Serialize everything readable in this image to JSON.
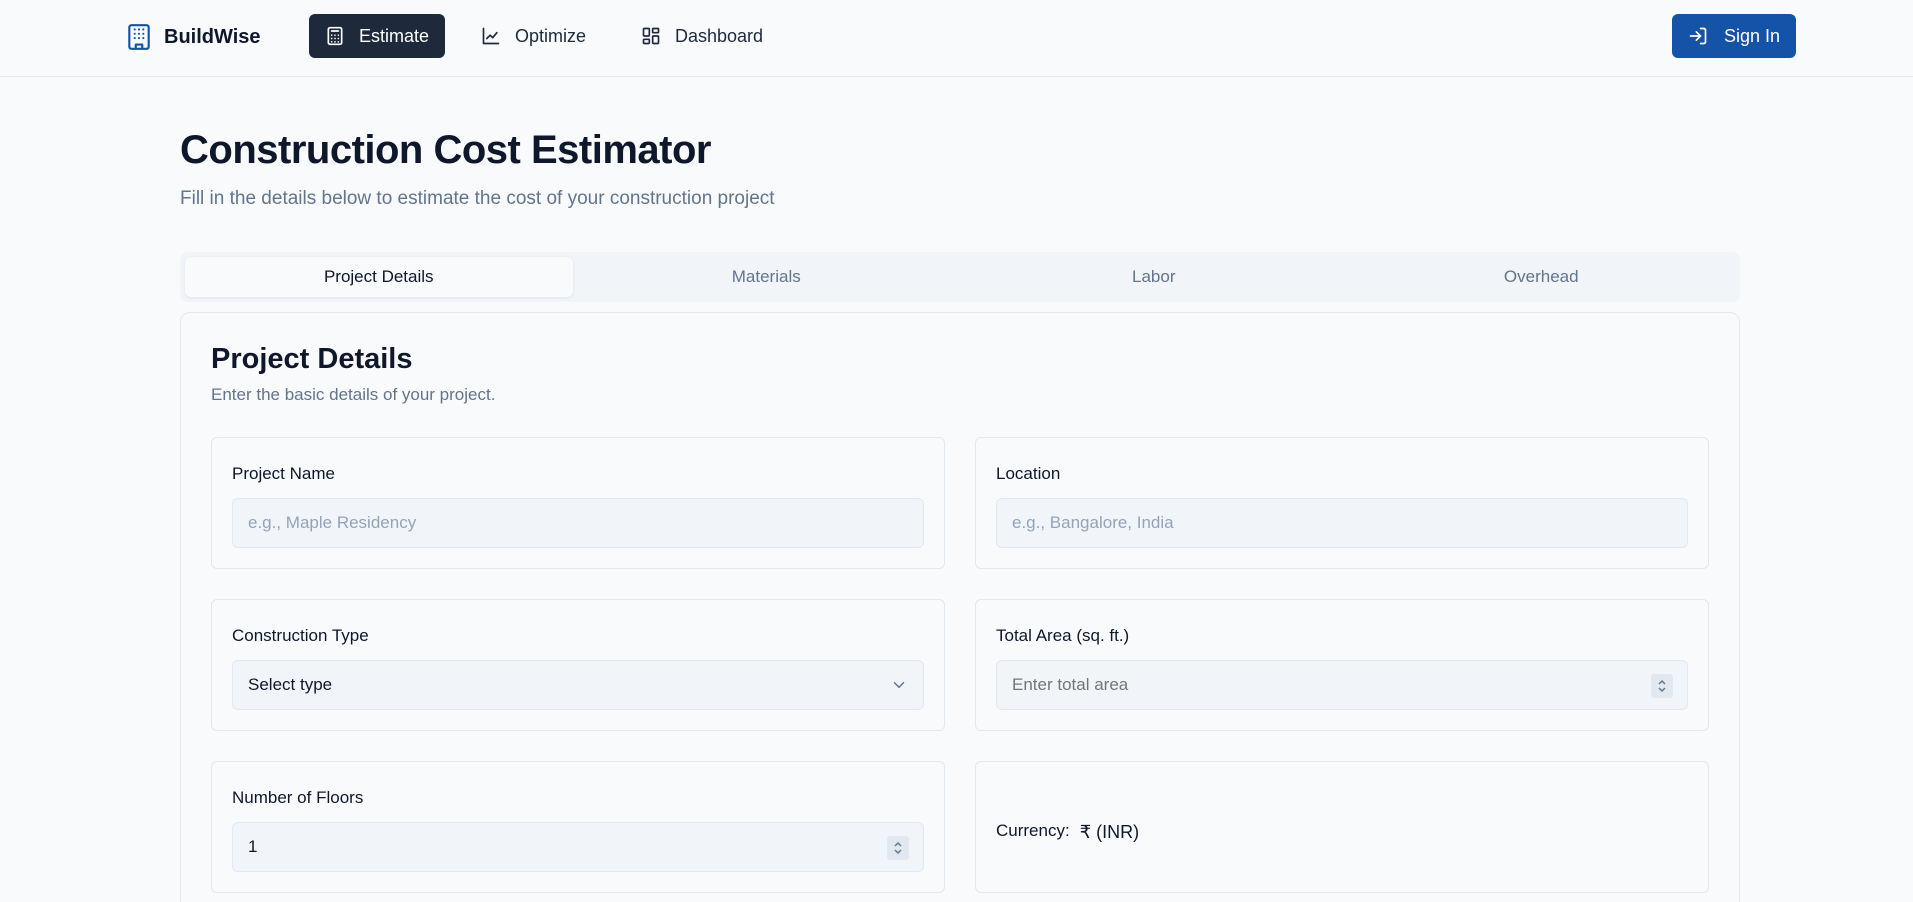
{
  "header": {
    "brand": "BuildWise",
    "nav": [
      {
        "label": "Estimate",
        "icon": "calculator-icon",
        "active": true
      },
      {
        "label": "Optimize",
        "icon": "line-chart-icon",
        "active": false
      },
      {
        "label": "Dashboard",
        "icon": "layout-dashboard-icon",
        "active": false
      }
    ],
    "signin_label": "Sign In"
  },
  "page": {
    "title": "Construction Cost Estimator",
    "subtitle": "Fill in the details below to estimate the cost of your construction project"
  },
  "tabs": [
    {
      "label": "Project Details",
      "active": true
    },
    {
      "label": "Materials",
      "active": false
    },
    {
      "label": "Labor",
      "active": false
    },
    {
      "label": "Overhead",
      "active": false
    }
  ],
  "card": {
    "title": "Project Details",
    "description": "Enter the basic details of your project."
  },
  "form": {
    "project_name": {
      "label": "Project Name",
      "placeholder": "e.g., Maple Residency",
      "value": ""
    },
    "location": {
      "label": "Location",
      "placeholder": "e.g., Bangalore, India",
      "value": ""
    },
    "construction_type": {
      "label": "Construction Type",
      "selected": "Select type"
    },
    "total_area": {
      "label": "Total Area (sq. ft.)",
      "placeholder": "Enter total area",
      "value": ""
    },
    "floors": {
      "label": "Number of Floors",
      "value": "1"
    },
    "currency": {
      "label": "Currency:",
      "value": "₹ (INR)"
    }
  },
  "colors": {
    "primary": "#1453a8",
    "active_nav": "#1e293b",
    "background": "#f8fafc",
    "muted_text": "#64748b"
  }
}
